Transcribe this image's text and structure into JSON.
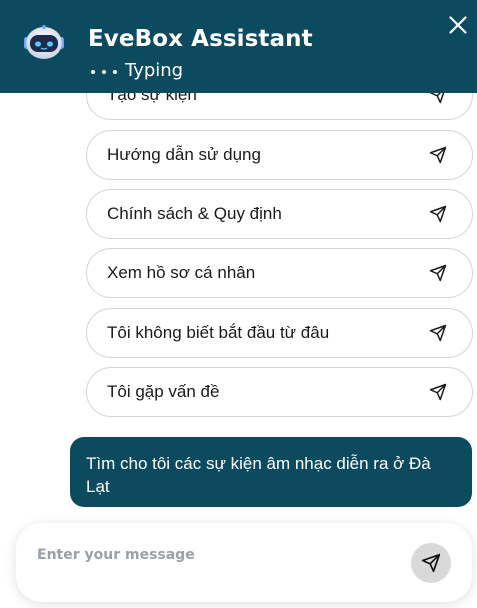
{
  "header": {
    "title": "EveBox Assistant",
    "status": "Typing",
    "avatar_icon": "robot-icon",
    "close_icon": "close-icon",
    "background": "#0c4a60"
  },
  "suggestions": [
    {
      "label": "Tạo sự kiện",
      "icon": "send-icon"
    },
    {
      "label": "Hướng dẫn sử dụng",
      "icon": "send-icon"
    },
    {
      "label": "Chính sách & Quy định",
      "icon": "send-icon"
    },
    {
      "label": "Xem hồ sơ cá nhân",
      "icon": "send-icon"
    },
    {
      "label": "Tôi không biết bắt đầu từ đâu",
      "icon": "send-icon"
    },
    {
      "label": "Tôi gặp vấn đề",
      "icon": "send-icon"
    }
  ],
  "user_message": {
    "text": "Tìm cho tôi các sự kiện âm nhạc diễn ra ở Đà Lạt",
    "background": "#0c4a60"
  },
  "composer": {
    "placeholder": "Enter your message",
    "value": "",
    "send_icon": "send-icon"
  }
}
